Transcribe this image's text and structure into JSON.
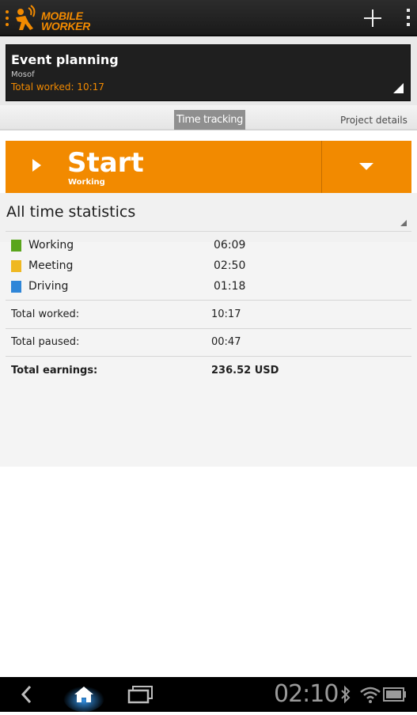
{
  "app": {
    "logo_line1": "MOBILE",
    "logo_line2": "WORKER",
    "brand_color": "#f28a00"
  },
  "project": {
    "title": "Event planning",
    "client": "Mosof",
    "total_worked": "Total worked: 10:17"
  },
  "tabs": {
    "time_tracking": "Time tracking",
    "project_details": "Project details"
  },
  "timer": {
    "start_label": "Start",
    "activity": "Working"
  },
  "stats": {
    "title": "All time statistics",
    "activities": [
      {
        "name": "Working",
        "time": "06:09",
        "color": "#5aa51c"
      },
      {
        "name": "Meeting",
        "time": "02:50",
        "color": "#efb822"
      },
      {
        "name": "Driving",
        "time": "01:18",
        "color": "#2f86d8"
      }
    ],
    "total_worked_label": "Total worked:",
    "total_worked_value": "10:17",
    "total_paused_label": "Total paused:",
    "total_paused_value": "00:47",
    "total_earnings_label": "Total earnings:",
    "total_earnings_value": "236.52 USD"
  },
  "system": {
    "clock": "02:10",
    "icons": [
      "back-icon",
      "home-icon",
      "recent-apps-icon",
      "bluetooth-icon",
      "wifi-icon",
      "battery-icon"
    ]
  }
}
